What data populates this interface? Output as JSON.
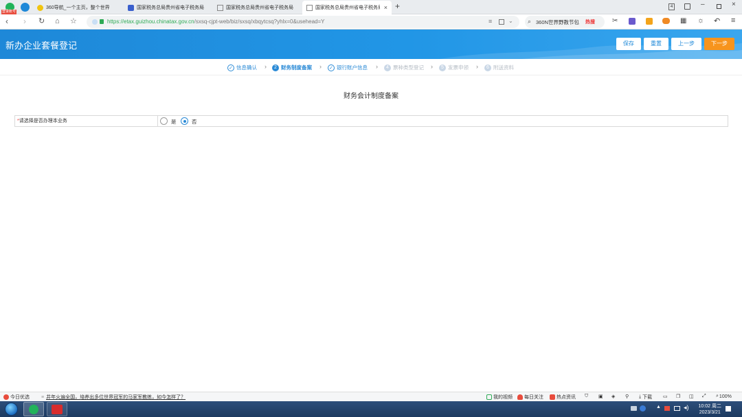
{
  "browser": {
    "login_badge": "登录账号",
    "tabs": [
      {
        "label": "360导航_一个主页，整个世界",
        "active": false
      },
      {
        "label": "国家税务总局贵州省电子税务局",
        "active": false
      },
      {
        "label": "国家税务总局贵州省电子税务局",
        "active": false
      },
      {
        "label": "国家税务总局贵州省电子税务局",
        "active": true
      }
    ],
    "tab_close": "×",
    "new_tab": "+",
    "tab_count": "4",
    "url_host": "https://etax.guizhou.chinatax.gov.cn",
    "url_path": "/sxsq-cjpt-web/biz/sxsq/xbqytcsq?yhlx=0&usehead=Y",
    "search_text": "360N世界野教节包",
    "search_badge": "热搜"
  },
  "header": {
    "title": "新办企业套餐登记",
    "buttons": {
      "save": "保存",
      "reset": "重置",
      "prev": "上一步",
      "next": "下一步"
    }
  },
  "steps": [
    {
      "num": "✓",
      "label": "信息确认",
      "state": "done"
    },
    {
      "num": "2",
      "label": "财务制度备案",
      "state": "current"
    },
    {
      "num": "✓",
      "label": "银行账户信息",
      "state": "done"
    },
    {
      "num": "4",
      "label": "票种类型登记",
      "state": "todo"
    },
    {
      "num": "5",
      "label": "发票申领",
      "state": "todo"
    },
    {
      "num": "6",
      "label": "附送资料",
      "state": "todo"
    }
  ],
  "step_arrow": "›",
  "main": {
    "title": "财务会计制度备案",
    "question": {
      "required_mark": "*",
      "label": "请选择是否办理本业务",
      "options": [
        {
          "label": "是",
          "selected": false
        },
        {
          "label": "否",
          "selected": true
        }
      ]
    }
  },
  "statusbar": {
    "today": "今日优选",
    "news": "井年火遍全国，培养出多位世界冠军的马家军教练，如今怎样了？",
    "my_video": "我的视频",
    "daily_focus": "每日关注",
    "hot_news": "热点资讯",
    "download": "下载",
    "zoom": "100%"
  },
  "taskbar": {
    "time": "10:02 周二",
    "date": "2023/3/21"
  },
  "colors": {
    "primary": "#2a8ad6",
    "header_bg": "#1e88d8",
    "next_button": "#f7941d"
  }
}
